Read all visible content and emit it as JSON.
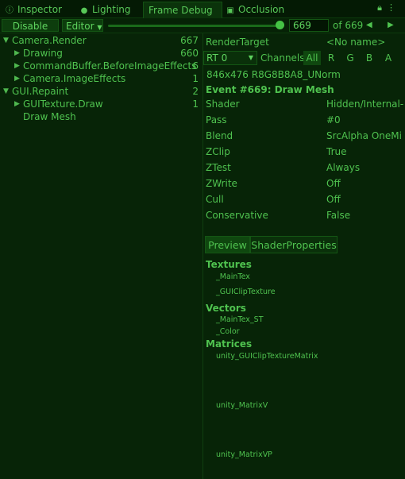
{
  "tabs": [
    {
      "label": "Inspector",
      "icon": "info-icon"
    },
    {
      "label": "Lighting",
      "icon": "lightbulb-icon"
    },
    {
      "label": "Frame Debug",
      "icon": "",
      "active": true
    },
    {
      "label": "Occlusion",
      "icon": "occlusion-icon"
    }
  ],
  "toolbar": {
    "disable_label": "Disable",
    "editor_label": "Editor",
    "event_value": "669",
    "of_label": "of 669",
    "prev_symbol": "◀",
    "next_symbol": "▶",
    "slider_fraction": 1.0
  },
  "tree": [
    {
      "label": "Camera.Render",
      "count": "667",
      "depth": 0,
      "expanded": true
    },
    {
      "label": "Drawing",
      "count": "660",
      "depth": 1,
      "expanded": false
    },
    {
      "label": "CommandBuffer.BeforeImageEffects",
      "count": "6",
      "depth": 1,
      "expanded": false
    },
    {
      "label": "Camera.ImageEffects",
      "count": "1",
      "depth": 1,
      "expanded": false
    },
    {
      "label": "GUI.Repaint",
      "count": "2",
      "depth": 0,
      "expanded": true
    },
    {
      "label": "GUITexture.Draw",
      "count": "1",
      "depth": 1,
      "expanded": false
    },
    {
      "label": "Draw Mesh",
      "count": "",
      "depth": 1,
      "leaf": true
    }
  ],
  "details": {
    "render_target_label": "RenderTarget",
    "render_target_value": "<No name>",
    "rt_select": "RT 0",
    "channels_label": "Channels",
    "channels": [
      "All",
      "R",
      "G",
      "B",
      "A"
    ],
    "format": "846x476 R8G8B8A8_UNorm",
    "event_title": "Event #669: Draw Mesh",
    "props": [
      {
        "name": "Shader",
        "value": "Hidden/Internal-"
      },
      {
        "name": "Pass",
        "value": "#0"
      },
      {
        "name": "Blend",
        "value": "SrcAlpha OneMi"
      },
      {
        "name": "ZClip",
        "value": "True"
      },
      {
        "name": "ZTest",
        "value": "Always"
      },
      {
        "name": "ZWrite",
        "value": "Off"
      },
      {
        "name": "Cull",
        "value": "Off"
      },
      {
        "name": "Conservative",
        "value": "False"
      }
    ],
    "tab_preview": "Preview",
    "tab_shader_props": "ShaderProperties",
    "textures_header": "Textures",
    "textures": [
      "_MainTex",
      "_GUIClipTexture"
    ],
    "vectors_header": "Vectors",
    "vectors": [
      "_MainTex_ST",
      "_Color"
    ],
    "matrices_header": "Matrices",
    "matrices": [
      "unity_GUIClipTextureMatrix",
      "unity_MatrixV",
      "unity_MatrixVP"
    ]
  },
  "colors": {
    "background": "#082608",
    "text": "#4fc24f",
    "accent": "#45c245"
  }
}
